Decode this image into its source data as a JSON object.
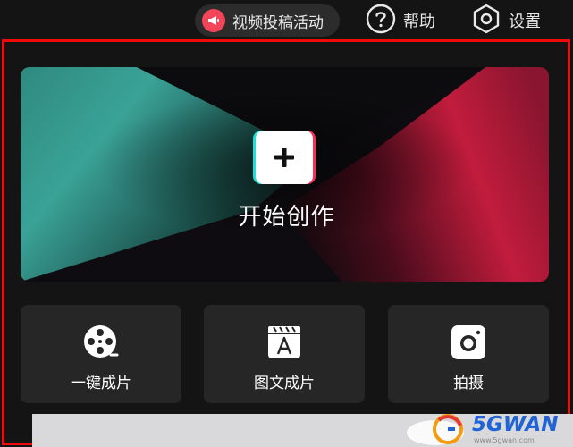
{
  "topbar": {
    "promo_label": "视频投稿活动",
    "help_label": "帮助",
    "settings_label": "设置"
  },
  "hero": {
    "label": "开始创作"
  },
  "tools": [
    {
      "label": "一键成片",
      "icon": "film-reel-icon"
    },
    {
      "label": "图文成片",
      "icon": "text-clapper-icon"
    },
    {
      "label": "拍摄",
      "icon": "camera-icon"
    }
  ],
  "watermark": {
    "brand": "5GWAN",
    "sub": "www.5gwan.com"
  },
  "colors": {
    "highlight_frame": "#f00a0a",
    "promo_accent": "#f2455a",
    "hero_teal": "#3aa297",
    "hero_crimson": "#c21c3c",
    "card_bg": "#262626",
    "watermark_blue": "#1e64d6"
  }
}
